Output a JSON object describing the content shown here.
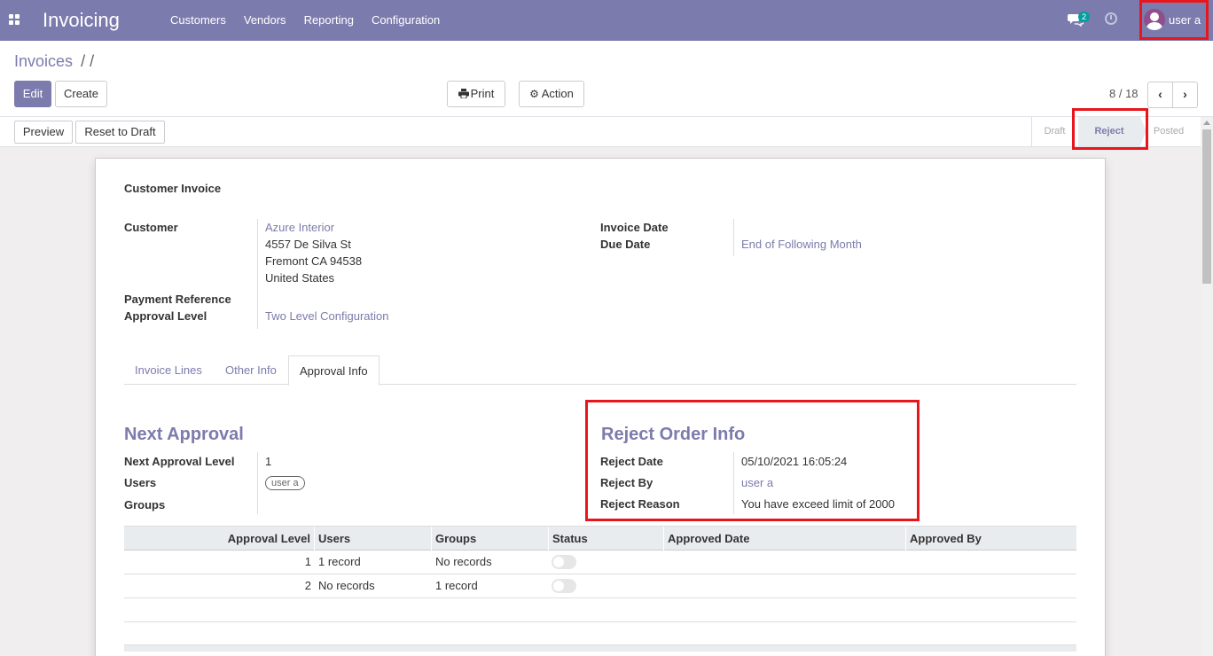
{
  "navbar": {
    "app_title": "Invoicing",
    "menu": [
      "Customers",
      "Vendors",
      "Reporting",
      "Configuration"
    ],
    "chat_count": "2",
    "user_name": "user a",
    "icons": [
      "apps-icon",
      "chat-icon",
      "clock-icon",
      "avatar"
    ]
  },
  "control_panel": {
    "breadcrumb_root": "Invoices",
    "breadcrumb_sep": "/ /",
    "edit_label": "Edit",
    "create_label": "Create",
    "print_label": "Print",
    "action_label": "Action",
    "pager": "8 / 18"
  },
  "statusbar": {
    "preview_label": "Preview",
    "reset_label": "Reset to Draft",
    "stages": [
      "Draft",
      "Reject",
      "Posted"
    ],
    "active_stage": "Reject"
  },
  "sheet": {
    "doc_type": "Customer Invoice",
    "customer_label": "Customer",
    "customer_name": "Azure Interior",
    "address": [
      "4557 De Silva St",
      "Fremont CA 94538",
      "United States"
    ],
    "payment_ref_label": "Payment Reference",
    "approval_level_label": "Approval Level",
    "approval_level_value": "Two Level Configuration",
    "invoice_date_label": "Invoice Date",
    "due_date_label": "Due Date",
    "due_date_value": "End of Following Month",
    "tabs": [
      "Invoice Lines",
      "Other Info",
      "Approval Info"
    ],
    "active_tab": "Approval Info"
  },
  "next_approval": {
    "title": "Next Approval",
    "level_label": "Next Approval Level",
    "level_value": "1",
    "users_label": "Users",
    "users_tag": "user a",
    "groups_label": "Groups"
  },
  "reject_info": {
    "title": "Reject Order Info",
    "date_label": "Reject Date",
    "date_value": "05/10/2021 16:05:24",
    "by_label": "Reject By",
    "by_value": "user a",
    "reason_label": "Reject Reason",
    "reason_value": "You have exceed limit of 2000"
  },
  "table": {
    "headers": [
      "Approval Level",
      "Users",
      "Groups",
      "Status",
      "Approved Date",
      "Approved By"
    ],
    "rows": [
      {
        "level": "1",
        "users": "1 record",
        "groups": "No records",
        "status": "off",
        "approved_date": "",
        "approved_by": ""
      },
      {
        "level": "2",
        "users": "No records",
        "groups": "1 record",
        "status": "off",
        "approved_date": "",
        "approved_by": ""
      }
    ]
  },
  "colors": {
    "brand": "#7c7bad",
    "highlight": "#e8161c",
    "badge": "#00a09d"
  }
}
